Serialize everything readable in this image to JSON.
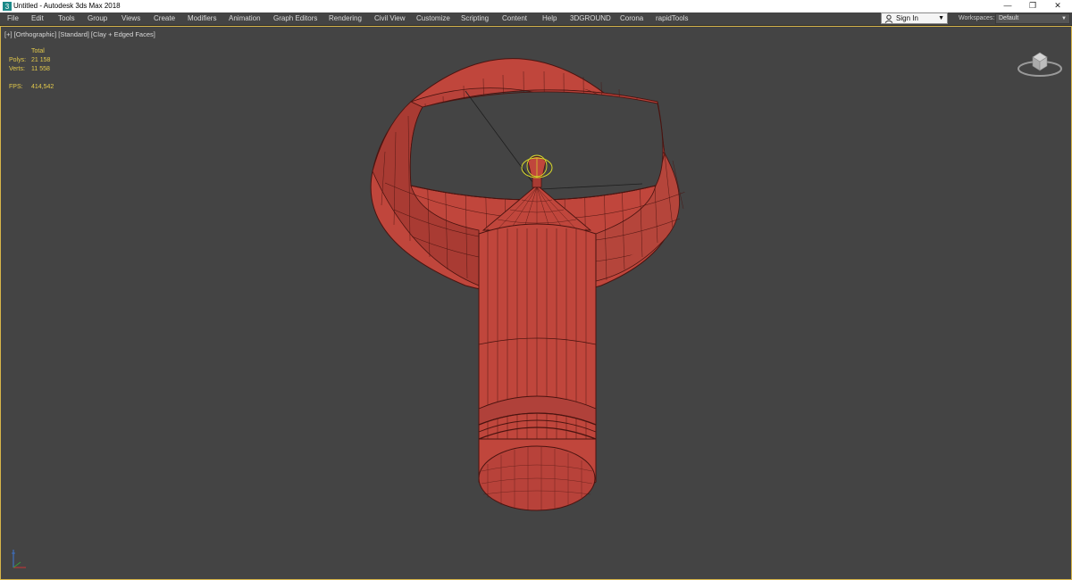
{
  "window": {
    "title": "Untitled - Autodesk 3ds Max 2018",
    "icon": "3dsmax-app-icon",
    "minimize_glyph": "—",
    "maximize_glyph": "❐",
    "close_glyph": "✕"
  },
  "menu": [
    "File",
    "Edit",
    "Tools",
    "Group",
    "Views",
    "Create",
    "Modifiers",
    "Animation",
    "Graph Editors",
    "Rendering",
    "Civil View",
    "Customize",
    "Scripting",
    "Content",
    "Help",
    "3DGROUND",
    "Corona",
    "rapidTools"
  ],
  "account": {
    "sign_in_label": "Sign In",
    "dropdown_glyph": "▼",
    "workspaces_label": "Workspaces:",
    "workspace_value": "Default"
  },
  "viewport": {
    "label": "[+] [Orthographic] [Standard] [Clay + Edged Faces]",
    "stats": {
      "total_label": "Total",
      "polys_label": "Polys:",
      "polys_value": "21 158",
      "verts_label": "Verts:",
      "verts_value": "11 558",
      "fps_label": "FPS:",
      "fps_value": "414,542"
    }
  },
  "colors": {
    "viewport_bg": "#444444",
    "mesh_fill": "#c0463c",
    "mesh_edge": "#4a1410",
    "stats_text": "#e3c94b",
    "viewport_border": "#d7b54a",
    "selection_gizmo": "#d9d92a"
  }
}
